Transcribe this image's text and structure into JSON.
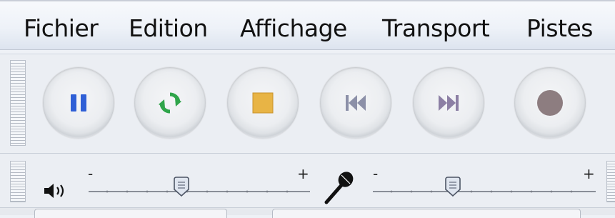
{
  "menu": {
    "items": [
      "Fichier",
      "Edition",
      "Affichage",
      "Transport",
      "Pistes"
    ]
  },
  "transport": {
    "buttons": [
      {
        "name": "pause",
        "icon": "pause-icon",
        "color": "#2f5fd6"
      },
      {
        "name": "loop-play",
        "icon": "loop-play-icon",
        "color": "#2fa54a"
      },
      {
        "name": "stop",
        "icon": "stop-icon",
        "color": "#e8b445"
      },
      {
        "name": "skip-to-start",
        "icon": "skip-to-start-icon",
        "color": "#8c90a8"
      },
      {
        "name": "skip-to-end",
        "icon": "skip-to-end-icon",
        "color": "#8c7fa4"
      },
      {
        "name": "record",
        "icon": "record-icon",
        "color": "#8d7d80"
      }
    ]
  },
  "mixer": {
    "playback": {
      "icon": "speaker-icon",
      "min_label": "-",
      "max_label": "+",
      "level": 0.42
    },
    "recording": {
      "icon": "microphone-icon",
      "min_label": "-",
      "max_label": "+",
      "level": 0.36
    }
  }
}
